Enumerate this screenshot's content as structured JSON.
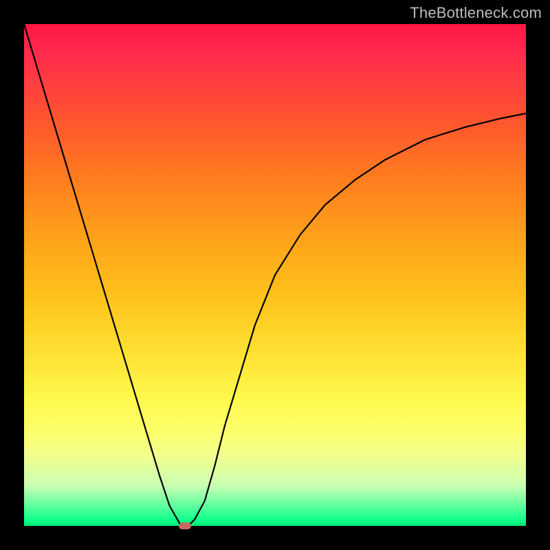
{
  "watermark": "TheBottleneck.com",
  "chart_data": {
    "type": "line",
    "title": "",
    "xlabel": "",
    "ylabel": "",
    "xlim": [
      0,
      100
    ],
    "ylim": [
      0,
      100
    ],
    "series": [
      {
        "name": "curve",
        "x": [
          0,
          3,
          6,
          9,
          12,
          15,
          18,
          21,
          24,
          27,
          29,
          31,
          32,
          33,
          34,
          36,
          38,
          40,
          43,
          46,
          50,
          55,
          60,
          66,
          72,
          80,
          88,
          95,
          100
        ],
        "y": [
          100,
          90,
          80,
          70,
          60,
          50,
          40,
          30,
          20,
          10,
          4,
          0.5,
          0,
          0.3,
          1.3,
          5,
          12,
          20,
          30,
          40,
          50,
          58,
          64,
          69,
          73,
          77,
          79.5,
          81.2,
          82.2
        ]
      }
    ],
    "marker": {
      "x": 32,
      "y": 0
    },
    "background_gradient": {
      "top": "#ff1744",
      "mid": "#ffd233",
      "bottom": "#00e676"
    }
  }
}
